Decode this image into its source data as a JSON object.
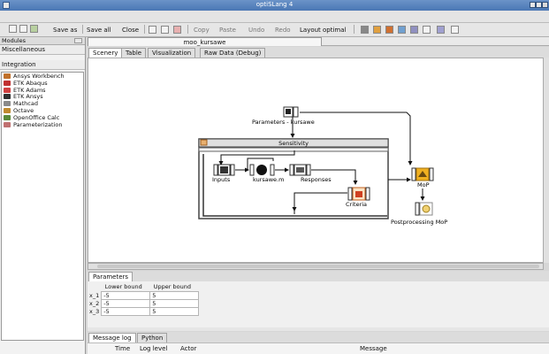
{
  "window": {
    "title": "optiSLang 4"
  },
  "toolbar": {
    "save_as": "Save as",
    "save_all": "Save all",
    "close": "Close",
    "copy": "Copy",
    "paste": "Paste",
    "undo": "Undo",
    "redo": "Redo",
    "layout_optimal": "Layout optimal"
  },
  "left_panel": {
    "modules_label": "Modules",
    "miscellaneous_label": "Miscellaneous",
    "integration_label": "Integration",
    "items": [
      {
        "label": "Ansys Workbench",
        "icon": "ansys-workbench-icon",
        "color": "#c0702a"
      },
      {
        "label": "ETK Abaqus",
        "icon": "etk-abaqus-icon",
        "color": "#c03030"
      },
      {
        "label": "ETK Adams",
        "icon": "etk-adams-icon",
        "color": "#d04040"
      },
      {
        "label": "ETK Ansys",
        "icon": "etk-ansys-icon",
        "color": "#303030"
      },
      {
        "label": "Mathcad",
        "icon": "mathcad-icon",
        "color": "#8a8a8a"
      },
      {
        "label": "Octave",
        "icon": "octave-icon",
        "color": "#c08a30"
      },
      {
        "label": "OpenOffice Calc",
        "icon": "openoffice-calc-icon",
        "color": "#5a8a3a"
      },
      {
        "label": "Parameterization",
        "icon": "parameterization-icon",
        "color": "#c07070"
      }
    ]
  },
  "editor": {
    "title": "moo_kursawe",
    "tabs": [
      "Scenery",
      "Table",
      "Visualization",
      "Raw Data (Debug)"
    ],
    "active_tab": "Scenery"
  },
  "canvas": {
    "parameters_node": "Parameters - kursawe",
    "sensitivity_label": "Sensitivity",
    "inputs_label": "Inputs",
    "script_label": "kursawe.m",
    "responses_label": "Responses",
    "criteria_label": "Criteria",
    "mop_label": "MoP",
    "postprocessing_label": "Postprocessing MoP"
  },
  "parameters": {
    "tab_label": "Parameters",
    "columns": [
      "Lower bound",
      "Upper bound"
    ],
    "rows": [
      {
        "name": "x_1",
        "lower": "-5",
        "upper": "5"
      },
      {
        "name": "x_2",
        "lower": "-5",
        "upper": "5"
      },
      {
        "name": "x_3",
        "lower": "-5",
        "upper": "5"
      }
    ]
  },
  "log": {
    "tabs": [
      "Message log",
      "Python"
    ],
    "columns": [
      "Time",
      "Log level",
      "Actor",
      "Message"
    ]
  },
  "colors": {
    "titlebar": "#4a77b4",
    "mop_node": "#f0b020"
  }
}
